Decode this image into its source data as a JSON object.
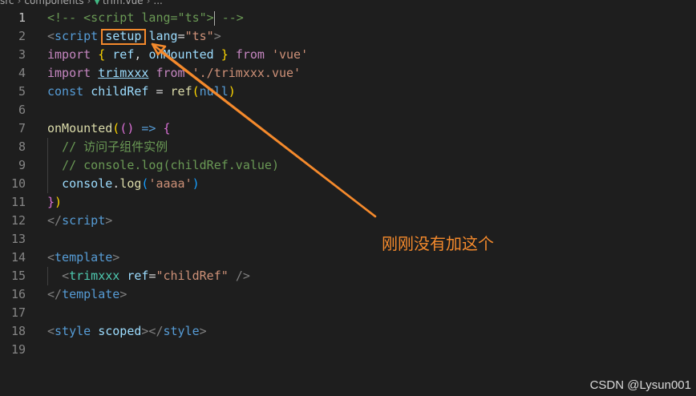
{
  "breadcrumb": {
    "items": [
      "src",
      "components",
      "trim.vue",
      "..."
    ],
    "file_icon": "vue-icon"
  },
  "editor": {
    "active_line": 1,
    "lines": [
      {
        "n": "1",
        "tokens": [
          [
            "c-comment",
            "<!-- <script lang=\"ts\">"
          ],
          [
            "cursor",
            ""
          ],
          [
            "c-comment",
            " -->"
          ]
        ]
      },
      {
        "n": "2",
        "tokens": [
          [
            "c-punct",
            "<"
          ],
          [
            "c-tag",
            "script"
          ],
          [
            "c-op",
            " "
          ],
          [
            "c-attr",
            "setup"
          ],
          [
            "c-op",
            " "
          ],
          [
            "c-attr",
            "lang"
          ],
          [
            "c-op",
            "="
          ],
          [
            "c-str",
            "\"ts\""
          ],
          [
            "c-punct",
            ">"
          ]
        ]
      },
      {
        "n": "3",
        "tokens": [
          [
            "c-kw",
            "import"
          ],
          [
            "c-op",
            " "
          ],
          [
            "c-y",
            "{"
          ],
          [
            "c-op",
            " "
          ],
          [
            "c-var",
            "ref"
          ],
          [
            "c-op",
            ", "
          ],
          [
            "c-var",
            "onMounted"
          ],
          [
            "c-op",
            " "
          ],
          [
            "c-y",
            "}"
          ],
          [
            "c-op",
            " "
          ],
          [
            "c-kw",
            "from"
          ],
          [
            "c-op",
            " "
          ],
          [
            "c-str",
            "'vue'"
          ]
        ]
      },
      {
        "n": "4",
        "tokens": [
          [
            "c-kw",
            "import"
          ],
          [
            "c-op",
            " "
          ],
          [
            "c-var ul",
            "trimxxx"
          ],
          [
            "c-op",
            " "
          ],
          [
            "c-kw",
            "from"
          ],
          [
            "c-op",
            " "
          ],
          [
            "c-str",
            "'./trimxxx.vue'"
          ]
        ]
      },
      {
        "n": "5",
        "tokens": [
          [
            "c-key",
            "const"
          ],
          [
            "c-op",
            " "
          ],
          [
            "c-var",
            "childRef"
          ],
          [
            "c-op",
            " = "
          ],
          [
            "c-fn",
            "ref"
          ],
          [
            "c-y",
            "("
          ],
          [
            "c-key",
            "null"
          ],
          [
            "c-y",
            ")"
          ]
        ]
      },
      {
        "n": "6",
        "tokens": []
      },
      {
        "n": "7",
        "tokens": [
          [
            "c-fn",
            "onMounted"
          ],
          [
            "c-y",
            "("
          ],
          [
            "c-p",
            "()"
          ],
          [
            "c-op",
            " "
          ],
          [
            "c-key",
            "=>"
          ],
          [
            "c-op",
            " "
          ],
          [
            "c-p",
            "{"
          ]
        ]
      },
      {
        "n": "8",
        "tokens": [
          [
            "c-op",
            "  "
          ],
          [
            "c-comment",
            "// 访问子组件实例"
          ]
        ]
      },
      {
        "n": "9",
        "tokens": [
          [
            "c-op",
            "  "
          ],
          [
            "c-comment",
            "// console.log(childRef.value)"
          ]
        ]
      },
      {
        "n": "10",
        "tokens": [
          [
            "c-op",
            "  "
          ],
          [
            "c-var",
            "console"
          ],
          [
            "c-op",
            "."
          ],
          [
            "c-fn",
            "log"
          ],
          [
            "c-b",
            "("
          ],
          [
            "c-str",
            "'aaaa'"
          ],
          [
            "c-b",
            ")"
          ]
        ]
      },
      {
        "n": "11",
        "tokens": [
          [
            "c-p",
            "}"
          ],
          [
            "c-y",
            ")"
          ]
        ]
      },
      {
        "n": "12",
        "tokens": [
          [
            "c-punct",
            "</"
          ],
          [
            "c-tag",
            "script"
          ],
          [
            "c-punct",
            ">"
          ]
        ]
      },
      {
        "n": "13",
        "tokens": []
      },
      {
        "n": "14",
        "tokens": [
          [
            "c-punct",
            "<"
          ],
          [
            "c-tag",
            "template"
          ],
          [
            "c-punct",
            ">"
          ]
        ]
      },
      {
        "n": "15",
        "tokens": [
          [
            "c-op",
            "  "
          ],
          [
            "c-punct",
            "<"
          ],
          [
            "c-comp",
            "trimxxx"
          ],
          [
            "c-op",
            " "
          ],
          [
            "c-attr",
            "ref"
          ],
          [
            "c-op",
            "="
          ],
          [
            "c-str",
            "\"childRef\""
          ],
          [
            "c-op",
            " "
          ],
          [
            "c-punct",
            "/>"
          ]
        ]
      },
      {
        "n": "16",
        "tokens": [
          [
            "c-punct",
            "</"
          ],
          [
            "c-tag",
            "template"
          ],
          [
            "c-punct",
            ">"
          ]
        ]
      },
      {
        "n": "17",
        "tokens": []
      },
      {
        "n": "18",
        "tokens": [
          [
            "c-punct",
            "<"
          ],
          [
            "c-tag",
            "style"
          ],
          [
            "c-op",
            " "
          ],
          [
            "c-attr",
            "scoped"
          ],
          [
            "c-punct",
            "></"
          ],
          [
            "c-tag",
            "style"
          ],
          [
            "c-punct",
            ">"
          ]
        ]
      },
      {
        "n": "19",
        "tokens": []
      }
    ]
  },
  "annotation": {
    "text": "刚刚没有加这个",
    "color": "#f58a2c"
  },
  "watermark": "CSDN @Lysun001"
}
